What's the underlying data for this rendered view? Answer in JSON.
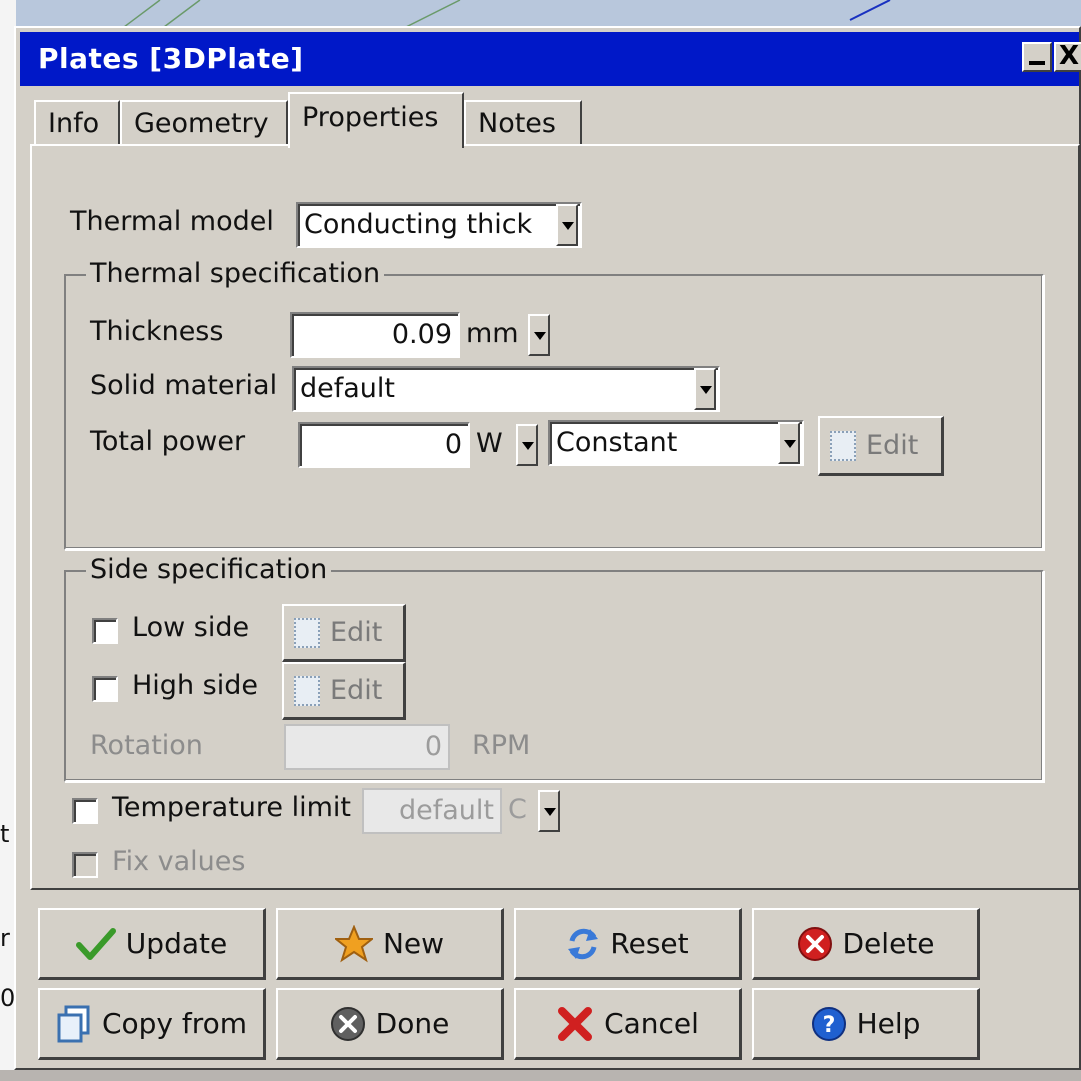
{
  "window": {
    "title": "Plates [3DPlate]",
    "minimize_label": "_",
    "close_label": "X"
  },
  "tabs": [
    {
      "label": "Info"
    },
    {
      "label": "Geometry"
    },
    {
      "label": "Properties"
    },
    {
      "label": "Notes"
    }
  ],
  "active_tab": "Properties",
  "thermal_model": {
    "label": "Thermal model",
    "value": "Conducting thick"
  },
  "thermal_spec": {
    "legend": "Thermal specification",
    "thickness": {
      "label": "Thickness",
      "value": "0.09",
      "unit": "mm"
    },
    "solid_material": {
      "label": "Solid material",
      "value": "default"
    },
    "total_power": {
      "label": "Total power",
      "value": "0",
      "unit": "W",
      "mode": "Constant",
      "edit_label": "Edit"
    }
  },
  "side_spec": {
    "legend": "Side specification",
    "low_side": {
      "label": "Low side",
      "checked": false,
      "edit_label": "Edit"
    },
    "high_side": {
      "label": "High side",
      "checked": false,
      "edit_label": "Edit"
    },
    "rotation": {
      "label": "Rotation",
      "value": "0",
      "unit": "RPM"
    }
  },
  "temperature_limit": {
    "label": "Temperature limit",
    "checked": false,
    "value": "default",
    "unit": "C"
  },
  "fix_values": {
    "label": "Fix values",
    "checked": false
  },
  "buttons": {
    "update": "Update",
    "new": "New",
    "reset": "Reset",
    "delete": "Delete",
    "copy_from": "Copy from",
    "done": "Done",
    "cancel": "Cancel",
    "help": "Help"
  },
  "colors": {
    "titlebar": "#0018c8",
    "dialog_bg": "#d4d0c8",
    "update_icon": "#3a9a2a",
    "new_icon": "#f0a020",
    "reset_icon": "#3a7ad8",
    "delete_icon": "#d02020",
    "cancel_icon": "#d02020",
    "help_icon": "#2060d0"
  },
  "background_fragments": [
    "t",
    "r",
    "0."
  ]
}
